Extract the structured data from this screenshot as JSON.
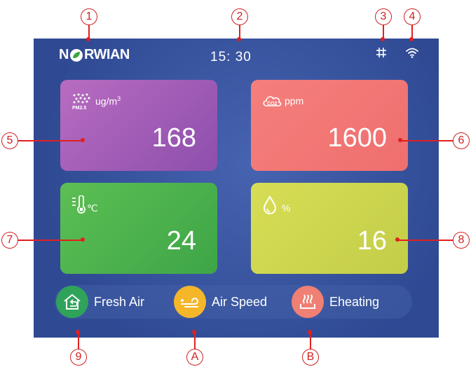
{
  "header": {
    "logo_text_left": "N",
    "logo_text_right": "RWIAN",
    "time": "15: 30"
  },
  "cards": {
    "pm25": {
      "icon": "pm2.5-icon",
      "unit_main": "ug/m",
      "unit_sup": "3",
      "value": "168",
      "color": "#a75db7"
    },
    "co2": {
      "icon": "co2-cloud-icon",
      "unit": "ppm",
      "value": "1600",
      "color": "#f07876"
    },
    "temperature": {
      "icon": "thermometer-icon",
      "unit": "℃",
      "value": "24",
      "color": "#4eb34d"
    },
    "humidity": {
      "icon": "water-drop-icon",
      "unit": "%",
      "value": "16",
      "color": "#cfd64f"
    }
  },
  "modes": [
    {
      "name": "fresh-air",
      "label": "Fresh Air",
      "color": "#2fa35a"
    },
    {
      "name": "air-speed",
      "label": "Air Speed",
      "color": "#f5b62a"
    },
    {
      "name": "eheating",
      "label": "Eheating",
      "color": "#f07f74"
    }
  ],
  "callouts": {
    "c1": "1",
    "c2": "2",
    "c3": "3",
    "c4": "4",
    "c5": "5",
    "c6": "6",
    "c7": "7",
    "c8": "8",
    "c9": "9",
    "cA": "A",
    "cB": "B"
  }
}
